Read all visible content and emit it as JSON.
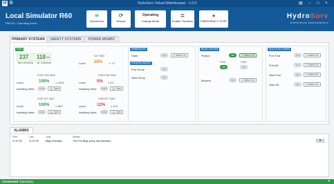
{
  "window": {
    "title": "HydroSurv Virtual Watchkeeper - 1.0.0",
    "logo": "H",
    "minimize": "–",
    "maximize": "□",
    "close": "×",
    "settings_icon": "gear-icon",
    "menu_icon": "book-icon"
  },
  "header": {
    "title": "Local Simulator R60",
    "subtitle": "R60-60 • Operating Mode",
    "buttons": [
      {
        "icon": "wifi-icon",
        "glyph": "≋",
        "label": "Disconnect"
      },
      {
        "icon": "refresh-icon",
        "glyph": "⟳",
        "label": "Resync"
      },
      {
        "icon": "mode-icon",
        "glyph": "Operating",
        "label": "Change Mode"
      },
      {
        "icon": "thrusters-icon",
        "glyph": "≣",
        "label": "Enable Thrusters"
      },
      {
        "icon": "emergency-stop-icon",
        "glyph": "●",
        "label": "EMERGENCY STOP"
      }
    ],
    "brand_main": "Hydro",
    "brand_accent": "Surv",
    "brand_sub": "Autonomous Hydrographics"
  },
  "tabs": [
    {
      "label": "PRIMARY SYSTEMS",
      "active": true
    },
    {
      "label": "SAFETY SYSTEMS",
      "active": false
    },
    {
      "label": "POWER MGMNT",
      "active": false
    }
  ],
  "fuel": {
    "header": "FUEL",
    "liters": "237",
    "liters_label": "liters remaining",
    "endurance": "118",
    "endurance_unit": "hrs",
    "endurance_label": "est. endurance",
    "day_tank": {
      "name": "DAY TANK",
      "level_label": "Level",
      "pct": "28%",
      "amount": "≈ 7 ℓ"
    },
    "port_fwd": {
      "name": "PORT FWD TANK",
      "level_label": "Level",
      "pct": "100%",
      "amount": "≈ 120 ℓ",
      "valve_label": "Isolating Valve",
      "valve_state": "OPEN",
      "action": "Open"
    },
    "stbd_fwd": {
      "name": "STBD FWD TANK",
      "level_label": "Level",
      "pct": "0%",
      "amount": "≈ 0 ℓ",
      "valve_label": "Isolating Valve",
      "valve_state": "OPEN",
      "action": "Open"
    },
    "port_aft": {
      "name": "PORT AFT TANK",
      "level_label": "Level",
      "pct": "100%",
      "amount": "≈ 98 ℓ",
      "valve_label": "Isolating Valve",
      "valve_state": "OPEN",
      "action": "Open"
    },
    "stbd_aft": {
      "name": "STBD AFT TANK",
      "level_label": "Level",
      "pct": "12%",
      "amount": "≈ 12 ℓ",
      "valve_label": "Isolating Valve",
      "valve_state": "OPEN",
      "action": "Open"
    }
  },
  "generator": {
    "header": "GENERATOR",
    "state_label": "State",
    "state": "OFF",
    "action": "Switch On"
  },
  "cooling": {
    "header": "COOLING WATER",
    "port_label": "Port Pump",
    "port_state": "OFF",
    "stbd_label": "Stbd Pump",
    "stbd_state": "OFF"
  },
  "bilge": {
    "header": "BILGE SYSTEM",
    "pumps_label": "Pumps",
    "pumps_state": "ON",
    "pumps_action": "Switch Off",
    "port_label": "PORT",
    "port_state": "ON",
    "stbd_label": "STBD",
    "stbd_state": "OFF",
    "blowers_label": "Blowers",
    "blowers_state": "OFF",
    "blowers_action": "Switch On"
  },
  "hull_fuel": {
    "header": "HULL FUEL PUMPS",
    "rows": [
      {
        "label": "Port Fwd",
        "state": "OFF",
        "action": "Switch On"
      },
      {
        "label": "Port Aft",
        "state": "OFF",
        "action": "Switch On"
      },
      {
        "label": "Stbd Fwd",
        "state": "OFF",
        "action": "Switch On"
      },
      {
        "label": "Stbd Aft",
        "state": "OFF",
        "action": "Switch On"
      }
    ]
  },
  "alarms": {
    "tab": "ALARMS",
    "headers": {
      "first": "First",
      "last": "Last",
      "type": "Type",
      "details": "Details"
    },
    "rows": [
      {
        "first": "11:47:00",
        "last": "11:47:00",
        "type": "Bilge Activation",
        "details": "The Port Bilge pump has activated."
      }
    ],
    "dismiss": "✖"
  },
  "status": {
    "connection": "Connected",
    "mode": "Operating",
    "wifi_icon": "wifi-icon",
    "wifi_glyph": "▾"
  },
  "colors": {
    "accent": "#155a98",
    "ok": "#2e9b3f",
    "warn": "#e88a1a",
    "alarm": "#d63a3a"
  }
}
